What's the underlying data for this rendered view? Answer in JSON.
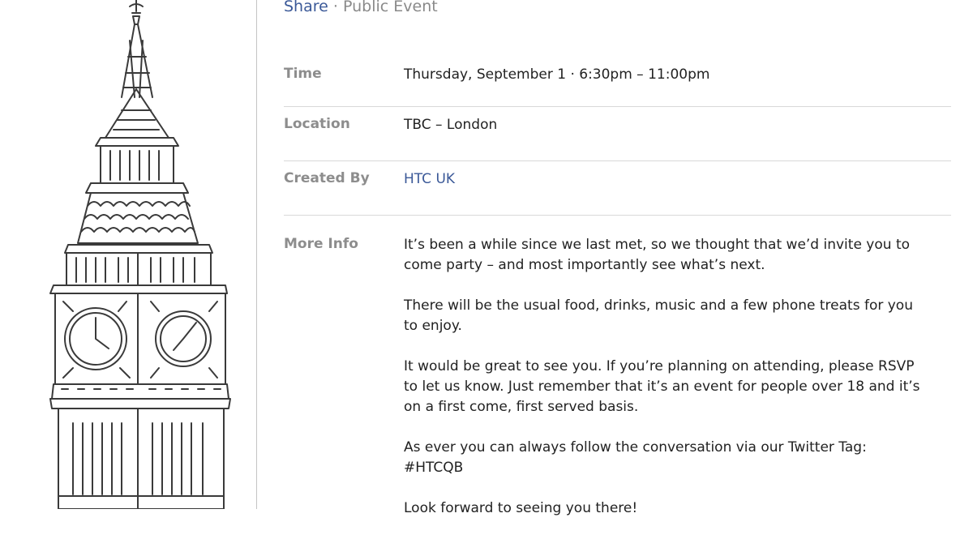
{
  "header": {
    "share_label": "Share",
    "separator": "·",
    "privacy": "Public Event"
  },
  "details": {
    "time": {
      "label": "Time",
      "value": "Thursday, September 1 · 6:30pm – 11:00pm"
    },
    "location": {
      "label": "Location",
      "value": "TBC – London"
    },
    "created_by": {
      "label": "Created By",
      "value": "HTC UK"
    },
    "more_info": {
      "label": "More Info",
      "paragraphs": [
        "It’s been a while since we last met, so we thought that we’d invite you to come party – and most importantly see what’s next.",
        "There will be the usual food, drinks, music and a few phone treats for you to enjoy.",
        "It would be great to see you. If you’re planning on attending, please RSVP to let us know. Just remember that it’s an event for people over 18 and it’s on a first come, first served basis.",
        "As ever you can always follow the conversation via our Twitter Tag: #HTCQB",
        "Look forward to seeing you there!"
      ]
    }
  },
  "colors": {
    "link": "#3b5998",
    "label": "#8d8d8d",
    "divider": "#d9d9d9"
  },
  "icons": {
    "illustration": "big-ben-sketch"
  }
}
